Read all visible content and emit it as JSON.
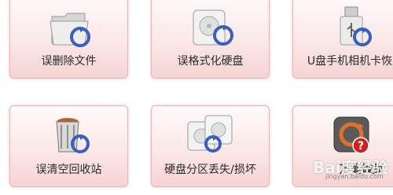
{
  "tiles": [
    {
      "label": "误删除文件",
      "icon": "folder-recover-icon"
    },
    {
      "label": "误格式化硬盘",
      "icon": "harddisk-recover-icon"
    },
    {
      "label": "U盘手机相机卡恢复",
      "icon": "usb-recover-icon"
    },
    {
      "label": "误清空回收站",
      "icon": "recycle-bin-recover-icon"
    },
    {
      "label": "硬盘分区丢失/损坏",
      "icon": "partition-recover-icon"
    },
    {
      "label": "万能恢复",
      "icon": "universal-recover-icon"
    }
  ],
  "watermark": {
    "text": "Bai度经验",
    "url": "jingyan.baidu.com"
  },
  "colors": {
    "tile_border": "#e8b8b8",
    "recover_arrow": "#3a5fc0",
    "tile_bg_bottom": "#f6d3d3"
  }
}
